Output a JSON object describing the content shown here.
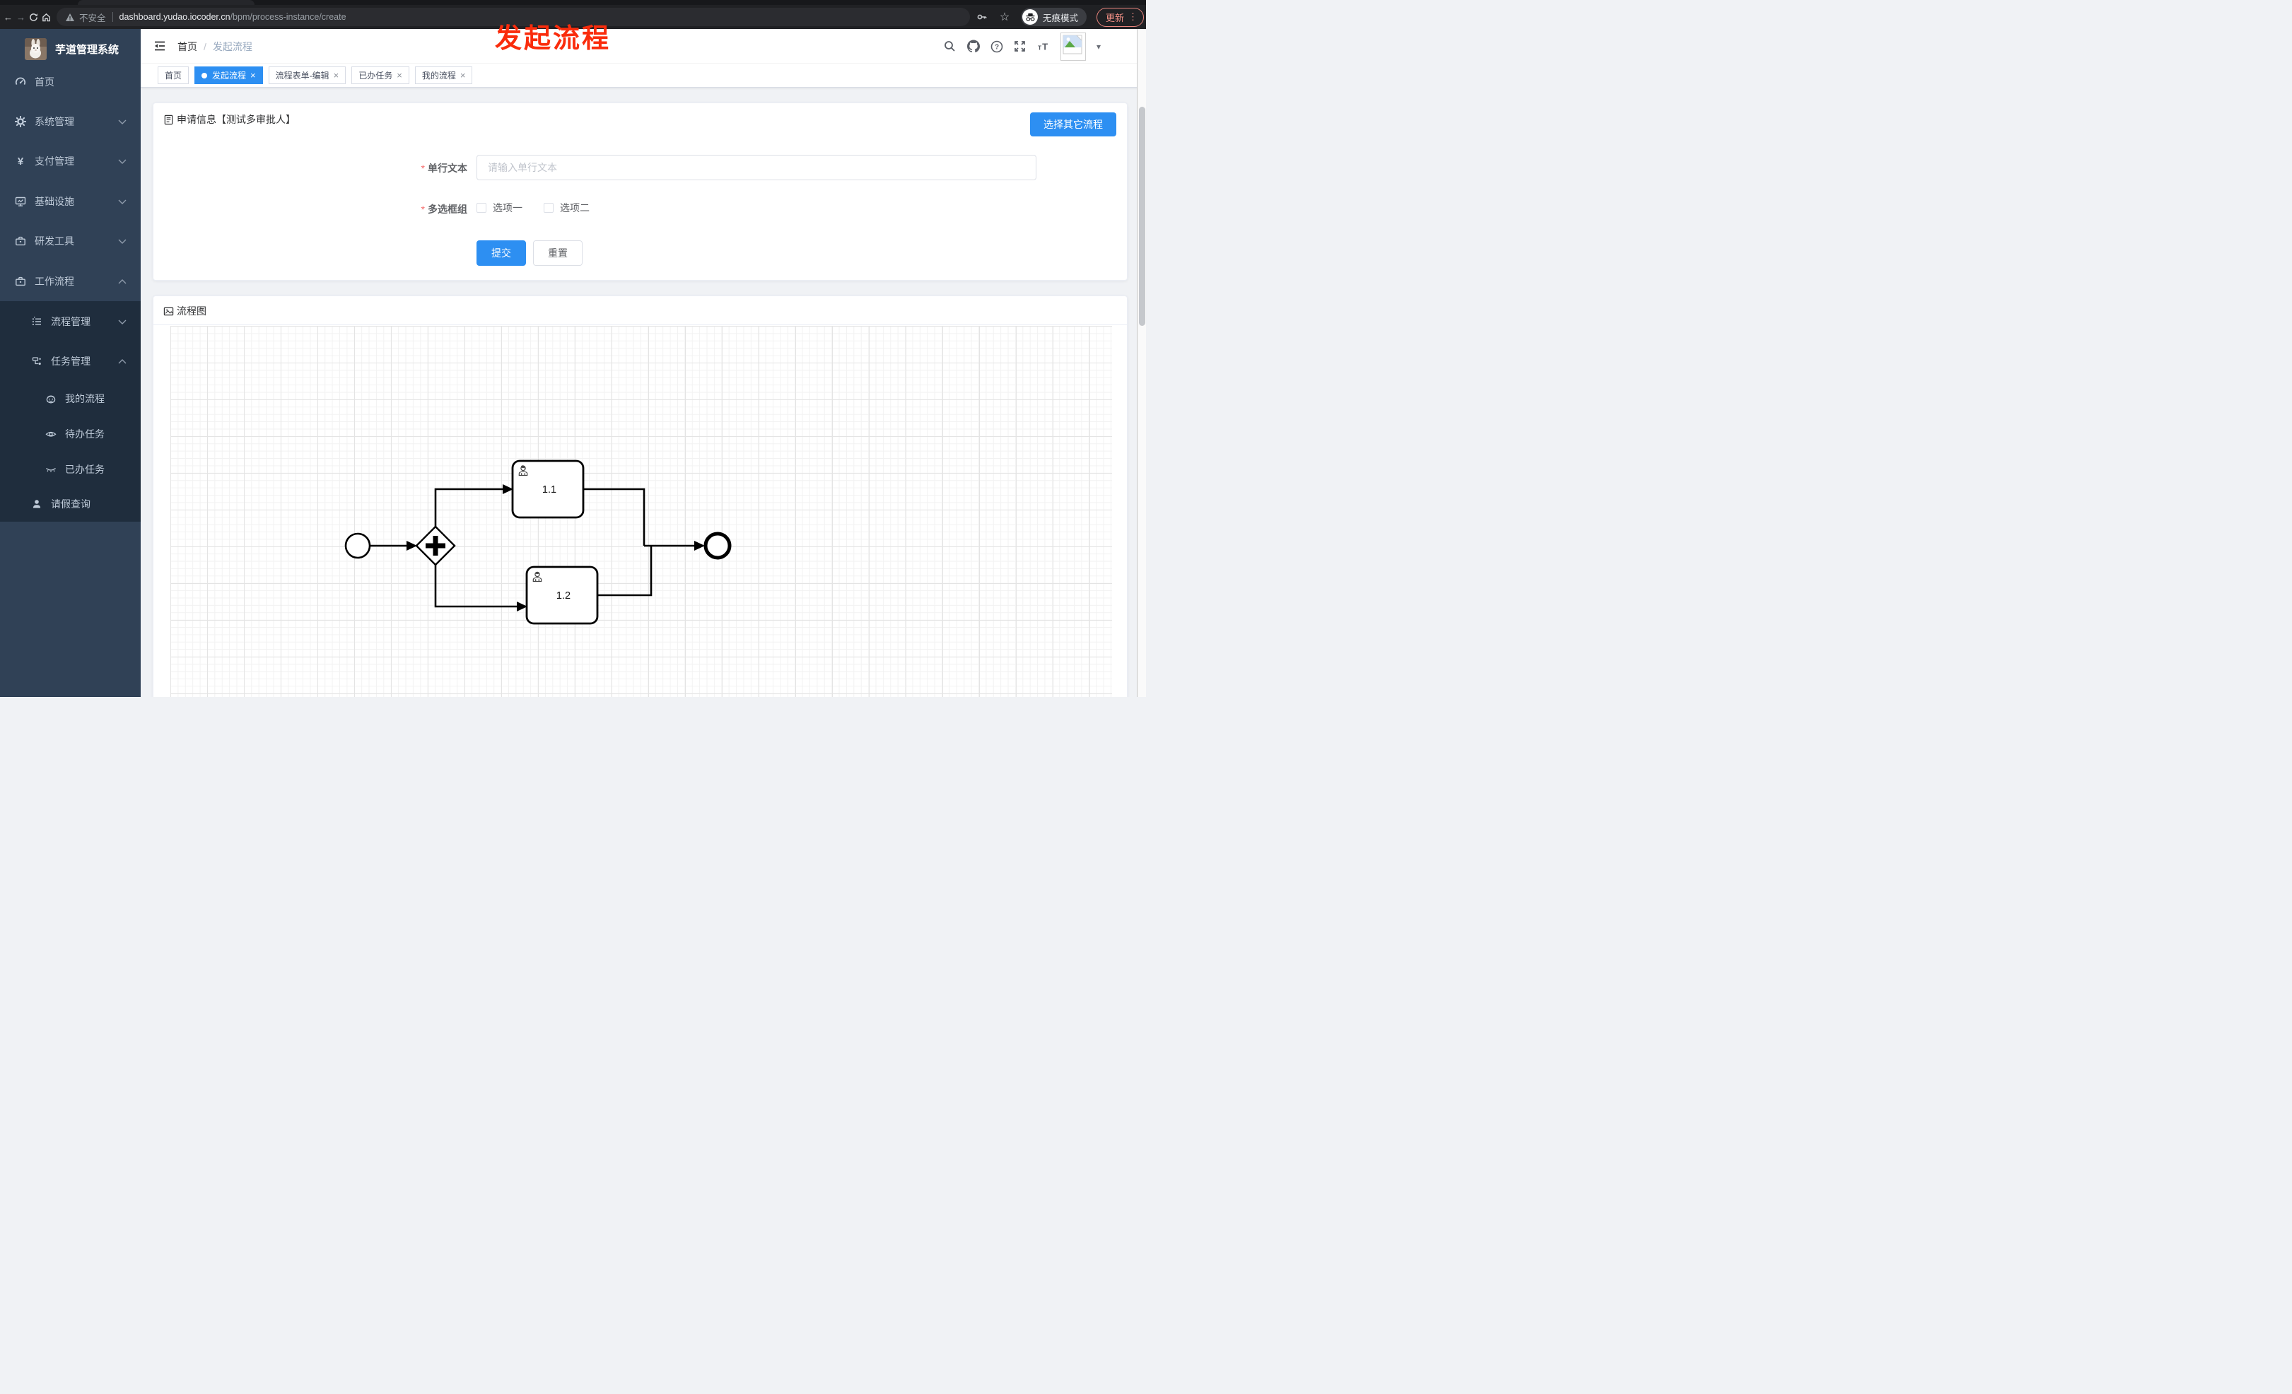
{
  "browser": {
    "security_label": "不安全",
    "url_host": "dashboard.yudao.iocoder.cn",
    "url_path": "/bpm/process-instance/create",
    "incognito_label": "无痕模式",
    "update_label": "更新"
  },
  "annotation": {
    "text": "发起流程"
  },
  "sidebar": {
    "title": "芋道管理系统",
    "items": [
      {
        "label": "首页",
        "icon": "dashboard-icon",
        "level": 1
      },
      {
        "label": "系统管理",
        "icon": "gear-icon",
        "level": 1,
        "chevron": "down"
      },
      {
        "label": "支付管理",
        "icon": "yen-icon",
        "level": 1,
        "chevron": "down"
      },
      {
        "label": "基础设施",
        "icon": "monitor-icon",
        "level": 1,
        "chevron": "down"
      },
      {
        "label": "研发工具",
        "icon": "toolbox-icon",
        "level": 1,
        "chevron": "down"
      },
      {
        "label": "工作流程",
        "icon": "briefcase-icon",
        "level": 1,
        "chevron": "up"
      },
      {
        "label": "流程管理",
        "icon": "flow-list-icon",
        "level": 2,
        "chevron": "down"
      },
      {
        "label": "任务管理",
        "icon": "task-tree-icon",
        "level": 2,
        "chevron": "up"
      },
      {
        "label": "我的流程",
        "icon": "face-icon",
        "level": 3
      },
      {
        "label": "待办任务",
        "icon": "eye-icon",
        "level": 3
      },
      {
        "label": "已办任务",
        "icon": "eye-closed-icon",
        "level": 3
      },
      {
        "label": "请假查询",
        "icon": "user-icon",
        "level": 2
      }
    ]
  },
  "header": {
    "breadcrumb_home": "首页",
    "breadcrumb_separator": "/",
    "breadcrumb_current": "发起流程"
  },
  "tabs": [
    {
      "label": "首页",
      "active": false,
      "closable": false
    },
    {
      "label": "发起流程",
      "active": true,
      "closable": true
    },
    {
      "label": "流程表单-编辑",
      "active": false,
      "closable": true
    },
    {
      "label": "已办任务",
      "active": false,
      "closable": true
    },
    {
      "label": "我的流程",
      "active": false,
      "closable": true
    }
  ],
  "form_card": {
    "title": "申请信息【测试多审批人】",
    "action_button": "选择其它流程",
    "required_mark": "*",
    "fields": {
      "text": {
        "label": "单行文本",
        "placeholder": "请输入单行文本"
      },
      "checkbox": {
        "label": "多选框组",
        "options": [
          "选项一",
          "选项二"
        ]
      }
    },
    "submit_label": "提交",
    "reset_label": "重置"
  },
  "diagram_card": {
    "title": "流程图",
    "tasks": [
      "1.1",
      "1.2"
    ]
  },
  "ui": {
    "close_glyph": "×",
    "caret_glyph": "▾",
    "star_glyph": "☆",
    "back_glyph": "←",
    "forward_glyph": "→",
    "kebab_glyph": "⋮"
  },
  "colors": {
    "primary": "#2d8ff2",
    "sidebar_bg": "#304156",
    "sidebar_sub_bg": "#1f2d3d",
    "annotation_red": "#fa2c0c",
    "update_coral": "#f08f85"
  }
}
